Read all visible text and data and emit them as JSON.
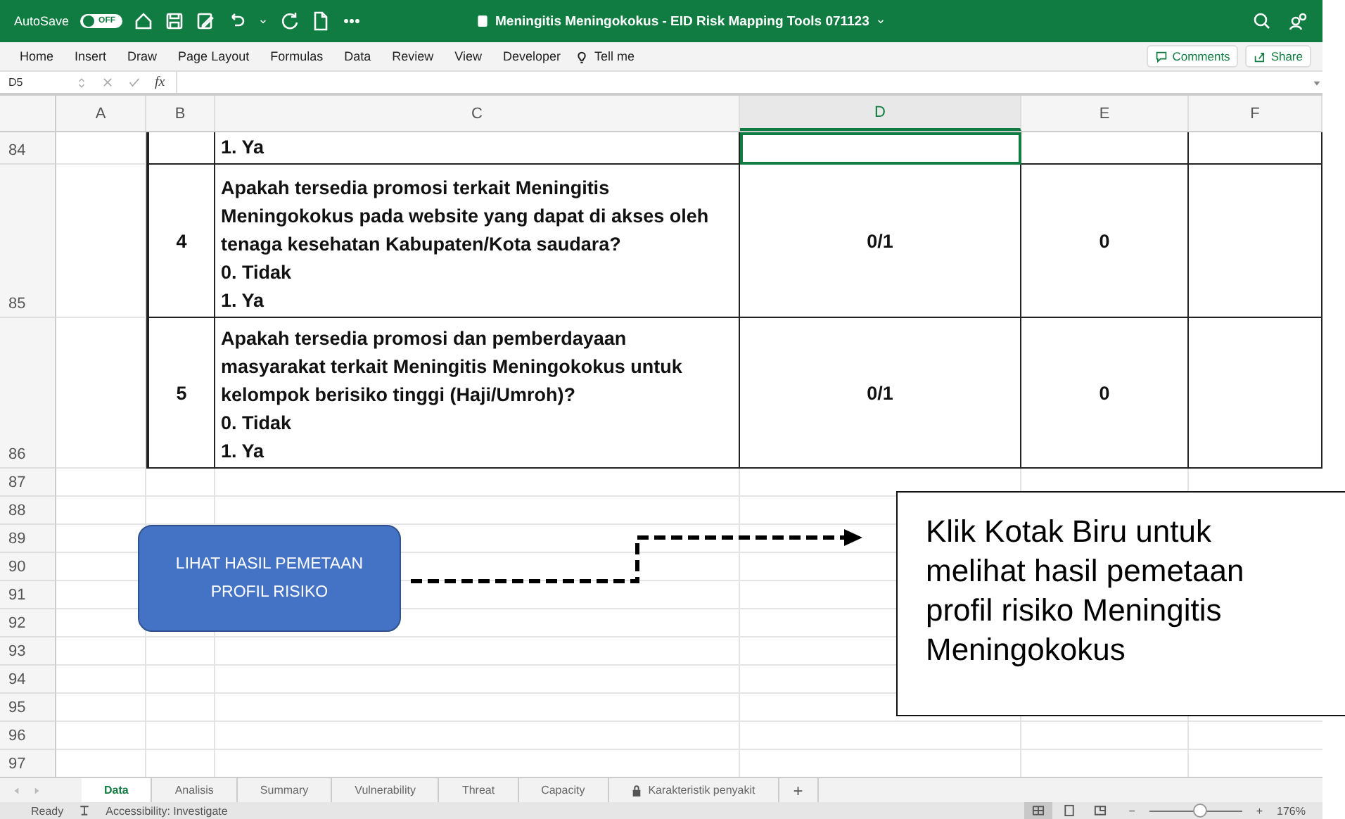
{
  "title_bar": {
    "autosave_label": "AutoSave",
    "autosave_state": "OFF",
    "autosave_on": false,
    "title": "Meningitis Meningokokus - EID Risk Mapping Tools 071123"
  },
  "menu": [
    "Home",
    "Insert",
    "Draw",
    "Page Layout",
    "Formulas",
    "Data",
    "Review",
    "View",
    "Developer"
  ],
  "tell_me": "Tell me",
  "ribbon_buttons": [
    "Comments",
    "Share"
  ],
  "formula_bar": {
    "cell_ref": "D5",
    "function_label": "fx"
  },
  "columns": [
    {
      "label": "A",
      "selected": false
    },
    {
      "label": "B",
      "selected": false
    },
    {
      "label": "C",
      "selected": false
    },
    {
      "label": "D",
      "selected": true
    },
    {
      "label": "E",
      "selected": false
    },
    {
      "label": "F",
      "selected": false
    }
  ],
  "rows": [
    {
      "number": "84",
      "no": "",
      "question": "",
      "options": [
        "1. Ya"
      ],
      "col_d": "",
      "col_e": "",
      "d_selected": true
    },
    {
      "number": "85",
      "no": "4",
      "question": "Apakah tersedia promosi terkait Meningitis Meningokokus pada website yang dapat di akses oleh tenaga kesehatan Kabupaten/Kota saudara?",
      "options": [
        "0. Tidak",
        "1. Ya"
      ],
      "col_d": "0/1",
      "col_e": "0",
      "d_selected": false
    },
    {
      "number": "86",
      "no": "5",
      "question": "Apakah tersedia promosi dan pemberdayaan masyarakat terkait Meningitis Meningokokus untuk kelompok berisiko tinggi (Haji/Umroh)?",
      "options": [
        "0. Tidak",
        "1. Ya"
      ],
      "col_d": "0/1",
      "col_e": "0",
      "d_selected": false
    }
  ],
  "empty_rows": [
    "87",
    "88",
    "89",
    "90",
    "91",
    "92",
    "93",
    "94",
    "95",
    "96",
    "97"
  ],
  "shape_button": "LIHAT HASIL PEMETAAN PROFIL RISIKO",
  "callout": "Klik Kotak Biru untuk melihat hasil pemetaan profil risiko Meningitis Meningokokus",
  "sheet_tabs": [
    {
      "label": "Data",
      "selected": true,
      "locked": false
    },
    {
      "label": "Analisis",
      "selected": false,
      "locked": false
    },
    {
      "label": "Summary",
      "selected": false,
      "locked": false
    },
    {
      "label": "Vulnerability",
      "selected": false,
      "locked": false
    },
    {
      "label": "Threat",
      "selected": false,
      "locked": false
    },
    {
      "label": "Capacity",
      "selected": false,
      "locked": false
    },
    {
      "label": "Karakteristik penyakit",
      "selected": false,
      "locked": true
    }
  ],
  "add_sheet": "+",
  "status_bar": {
    "status": "Ready",
    "accessibility": "Accessibility: Investigate",
    "zoom_out": "−",
    "zoom": {
      "level": 0.55
    },
    "zoom_in": "+",
    "zoom_percent": "176%"
  }
}
